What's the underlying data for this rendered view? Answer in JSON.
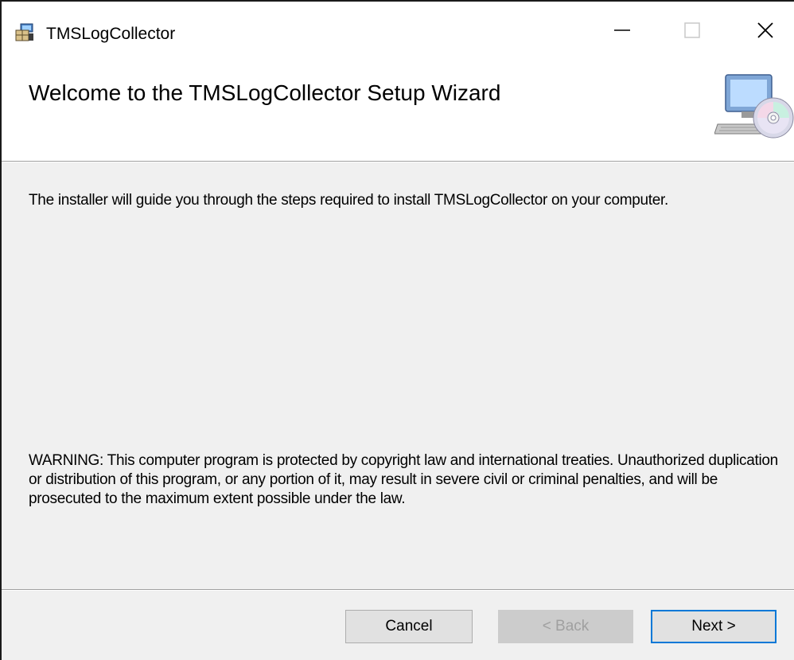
{
  "window": {
    "title": "TMSLogCollector",
    "icons": {
      "app": "installer-package-icon",
      "minimize": "minimize-icon",
      "maximize": "maximize-icon",
      "close": "close-icon"
    },
    "controls": {
      "minimize": "—",
      "maximize": "☐",
      "close": "✕"
    }
  },
  "banner": {
    "title": "Welcome to the TMSLogCollector Setup Wizard",
    "icon": "computer-cd-icon"
  },
  "body": {
    "intro": "The installer will guide you through the steps required to install TMSLogCollector on your computer.",
    "warning": "WARNING: This computer program is protected by copyright law and international treaties. Unauthorized duplication or distribution of this program, or any portion of it, may result in severe civil or criminal penalties, and will be prosecuted to the maximum extent possible under the law."
  },
  "buttons": {
    "cancel": "Cancel",
    "back": "< Back",
    "next": "Next >"
  },
  "colors": {
    "dialog_bg": "#f0f0f0",
    "header_bg": "#ffffff",
    "focus_border": "#0078d7",
    "disabled_text": "#a0a0a0"
  }
}
